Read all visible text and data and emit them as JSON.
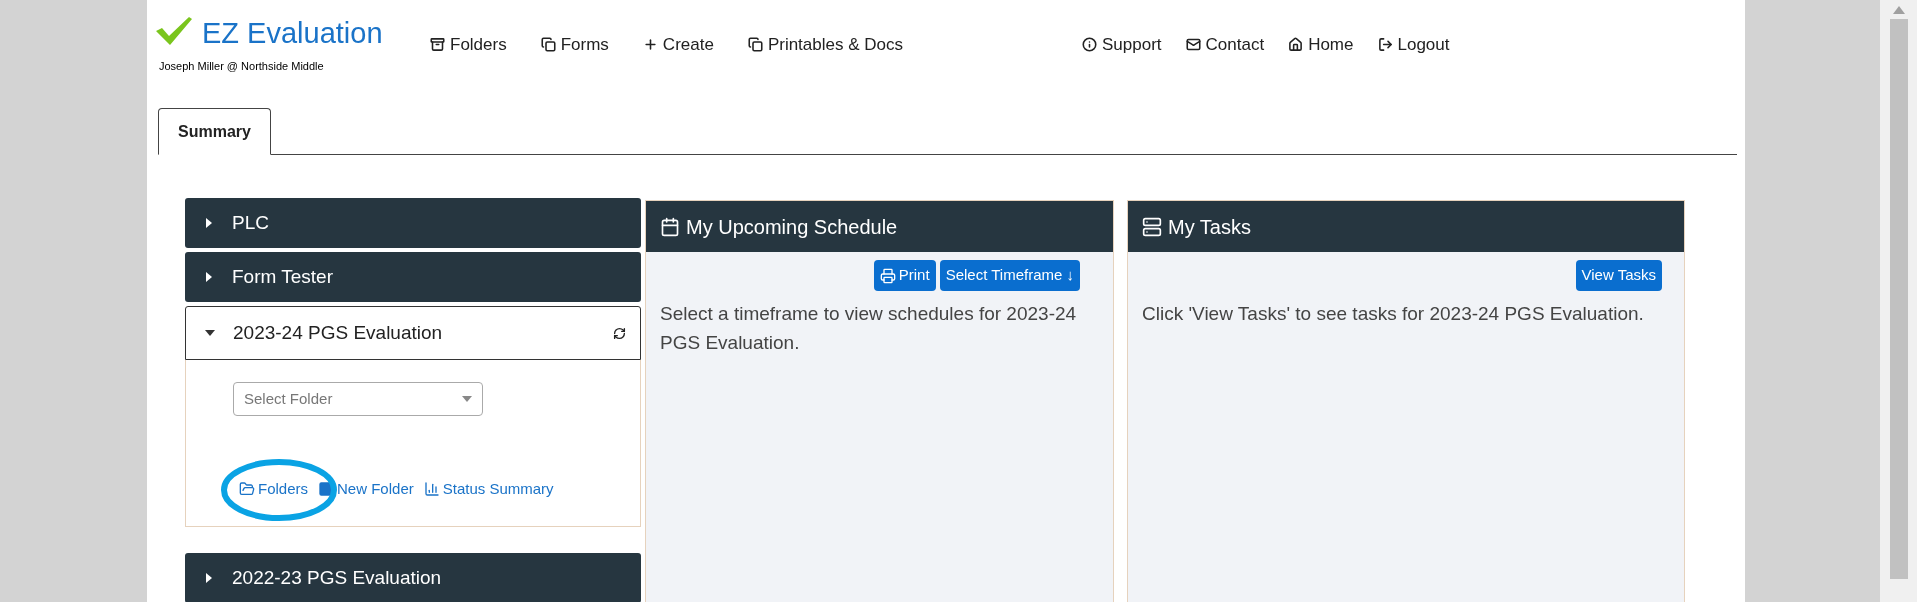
{
  "header": {
    "logo_text": "EZ Evaluation",
    "user": "Joseph Miller @ Northside Middle"
  },
  "nav_main": [
    "Folders",
    "Forms",
    "Create",
    "Printables & Docs"
  ],
  "nav_account": [
    "Support",
    "Contact",
    "Home",
    "Logout"
  ],
  "tabs": [
    {
      "label": "Summary",
      "selected": true
    }
  ],
  "evaluations": [
    {
      "title": "PLC",
      "expanded": false
    },
    {
      "title": "Form Tester",
      "expanded": false
    },
    {
      "title": "2023-24 PGS Evaluation",
      "expanded": true,
      "select": {
        "placeholder": "Select Folder"
      },
      "links": [
        "Folders",
        "New Folder",
        "Status Summary"
      ]
    },
    {
      "title": "2022-23 PGS Evaluation",
      "expanded": false
    }
  ],
  "schedule": {
    "title": "My Upcoming Schedule",
    "buttons": [
      "Print",
      "Select Timeframe ↓"
    ],
    "message": "Select a timeframe to view schedules for 2023-24 PGS Evaluation."
  },
  "tasks": {
    "title": "My Tasks",
    "buttons": [
      "View Tasks"
    ],
    "message": "Click 'View Tasks' to see tasks for 2023-24 PGS Evaluation."
  }
}
